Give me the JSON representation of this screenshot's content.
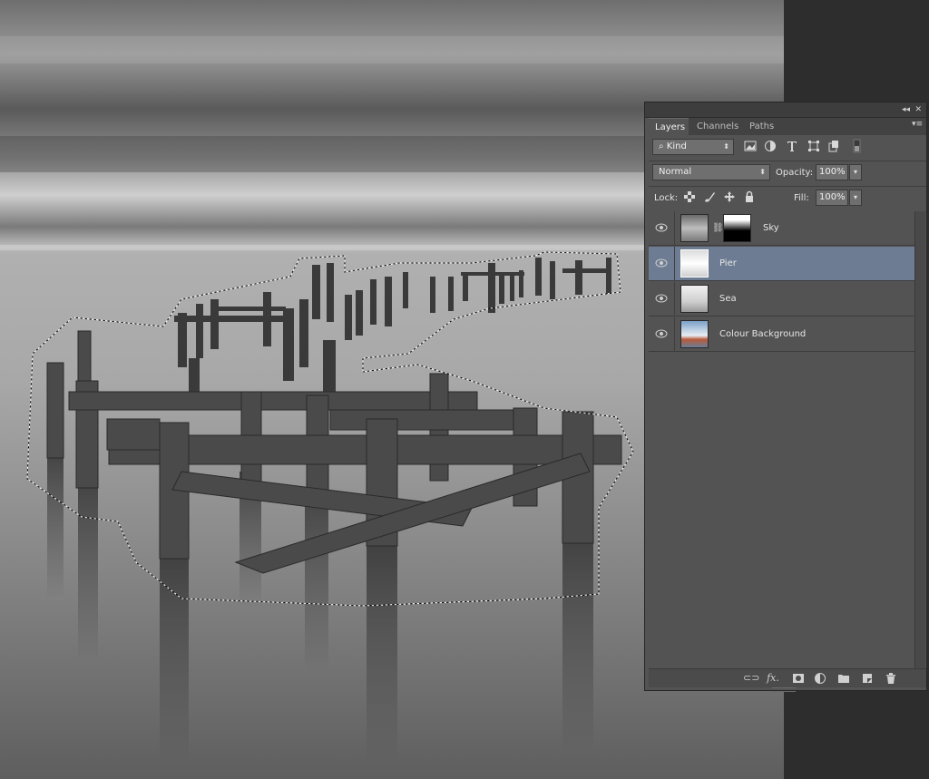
{
  "panel": {
    "collapse_glyph": "◂◂",
    "close_glyph": "✕",
    "menu_glyph": "▾≡",
    "tabs": [
      {
        "label": "Layers",
        "active": true
      },
      {
        "label": "Channels",
        "active": false
      },
      {
        "label": "Paths",
        "active": false
      }
    ],
    "filter": {
      "label": "Kind",
      "icons": [
        "image-filter-icon",
        "adjustment-filter-icon",
        "type-filter-icon",
        "shape-filter-icon",
        "smart-object-filter-icon",
        "filter-toggle-icon"
      ]
    },
    "blend_mode": "Normal",
    "opacity_label": "Opacity:",
    "opacity_value": "100%",
    "lock_label": "Lock:",
    "fill_label": "Fill:",
    "fill_value": "100%",
    "layers": [
      {
        "name": "Sky",
        "visible": true,
        "selected": false,
        "has_mask": true
      },
      {
        "name": "Pier",
        "visible": true,
        "selected": true,
        "has_mask": false
      },
      {
        "name": "Sea",
        "visible": true,
        "selected": false,
        "has_mask": false
      },
      {
        "name": "Colour Background",
        "visible": true,
        "selected": false,
        "has_mask": false
      }
    ],
    "bottom_icons": [
      "link-layers-icon",
      "fx-icon",
      "add-mask-icon",
      "adjustment-layer-icon",
      "new-group-icon",
      "new-layer-icon",
      "trash-icon"
    ],
    "fx_glyph": "fx."
  },
  "colors": {
    "selected_layer": "#6d7c93",
    "panel_bg": "#535353"
  }
}
